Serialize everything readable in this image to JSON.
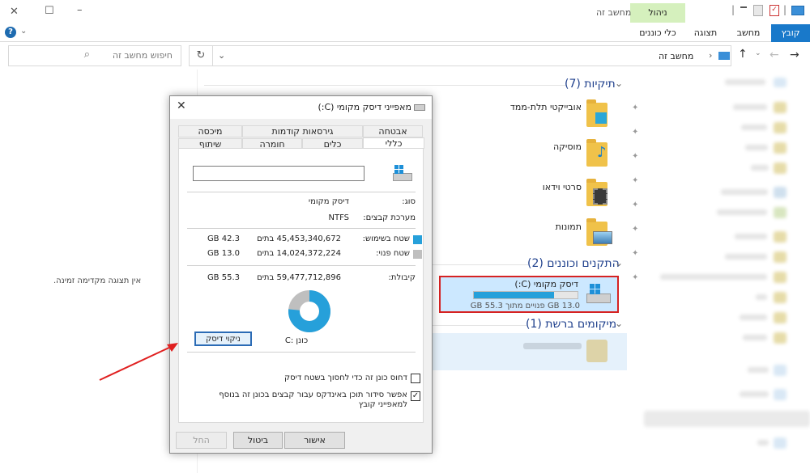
{
  "window": {
    "title": "מחשב זה",
    "manage_label": "ניהול",
    "minimize": "–",
    "maximize": "☐",
    "close": "✕"
  },
  "ribbon": {
    "tabs": [
      {
        "label": "קובץ"
      },
      {
        "label": "מחשב"
      },
      {
        "label": "תצוגה"
      },
      {
        "label": "כלי כוננים"
      }
    ]
  },
  "address": {
    "path": "מחשב זה",
    "search_placeholder": "חיפוש מחשב זה"
  },
  "preview": {
    "text": "אין תצוגה מקדימה זמינה."
  },
  "content": {
    "folders_header": "תיקיות (7)",
    "folders": [
      {
        "label": "אובייקטי תלת-ממד"
      },
      {
        "label": "מוסיקה"
      },
      {
        "label": "סרטי וידאו"
      },
      {
        "label": "תמונות"
      }
    ],
    "devices_header": "התקנים וכוננים (2)",
    "drive": {
      "name": "דיסק מקומי (C:)",
      "space": "13.0 GB פנויים מתוך 55.3 GB",
      "used_fraction": 0.77
    },
    "network_header": "מיקומים ברשת (1)"
  },
  "dialog": {
    "title": "מאפייני דיסק מקומי (C:)",
    "tabs_row1": [
      "אבטחה",
      "גירסאות קודמות",
      "מיכסה"
    ],
    "tabs_row2": [
      "כללי",
      "כלים",
      "חומרה",
      "שיתוף"
    ],
    "name_value": "",
    "type_label": "סוג:",
    "type_value": "דיסק מקומי",
    "fs_label": "מערכת קבצים:",
    "fs_value": "NTFS",
    "used_label": "שטח בשימוש:",
    "used_bytes": "45,453,340,672 בתים",
    "used_gb": "42.3 GB",
    "free_label": "שטח פנוי:",
    "free_bytes": "14,024,372,224 בתים",
    "free_gb": "13.0 GB",
    "capacity_label": "קיבולת:",
    "capacity_bytes": "59,477,712,896 בתים",
    "capacity_gb": "55.3 GB",
    "drive_label": "כונן :C",
    "cleanup_button": "ניקוי דיסק",
    "compress_label": "דחוס כונן זה כדי לחסוך בשטח דיסק",
    "index_label": "אפשר סידור תוכן באינדקס עבור קבצים בכונן זה בנוסף למאפייני קובץ",
    "ok_button": "אישור",
    "cancel_button": "ביטול",
    "apply_button": "החל",
    "used_color": "#26a0da",
    "free_color": "#bfbfbf"
  }
}
